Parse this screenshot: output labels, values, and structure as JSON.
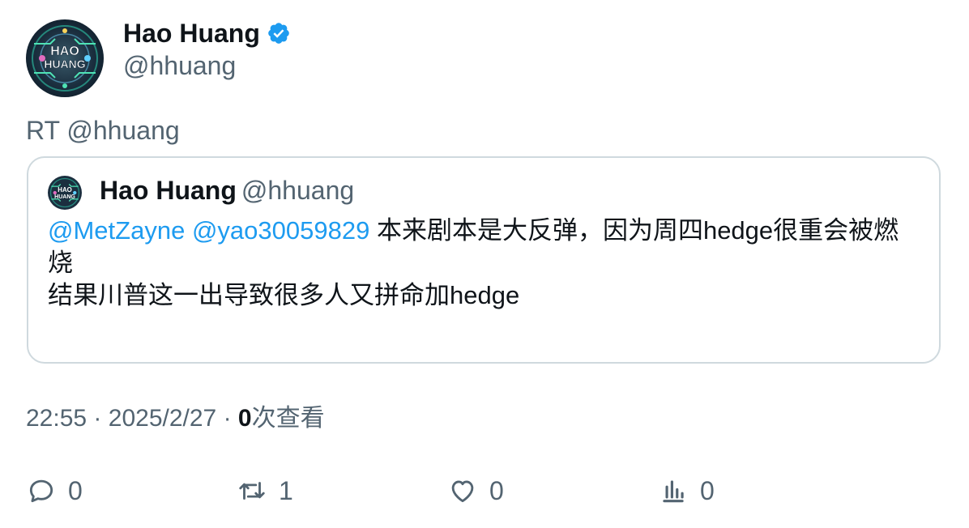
{
  "author": {
    "name": "Hao Huang",
    "handle": "@hhuang",
    "avatar_text_line1": "HAO",
    "avatar_text_line2": "HUANG",
    "verified_color": "#1d9bf0"
  },
  "retweet_prefix": "RT @hhuang",
  "quote": {
    "name": "Hao Huang",
    "handle": "@hhuang",
    "mentions": [
      "@MetZayne",
      "@yao30059829"
    ],
    "text_line1": "本来剧本是大反弹，因为周四hedge很重会被燃烧",
    "text_line2": "结果川普这一出导致很多人又拼命加hedge"
  },
  "meta": {
    "time": "22:55",
    "date": "2025/2/27",
    "separator": "·",
    "views_count": "0",
    "views_label": "次查看"
  },
  "actions": {
    "reply": {
      "icon": "reply-icon",
      "count": "0"
    },
    "retweet": {
      "icon": "retweet-icon",
      "count": "1"
    },
    "like": {
      "icon": "heart-icon",
      "count": "0"
    },
    "views": {
      "icon": "analytics-icon",
      "count": "0"
    }
  },
  "colors": {
    "text_primary": "#0f1419",
    "text_secondary": "#536471",
    "link": "#1d9bf0",
    "border": "#cfd9de"
  }
}
